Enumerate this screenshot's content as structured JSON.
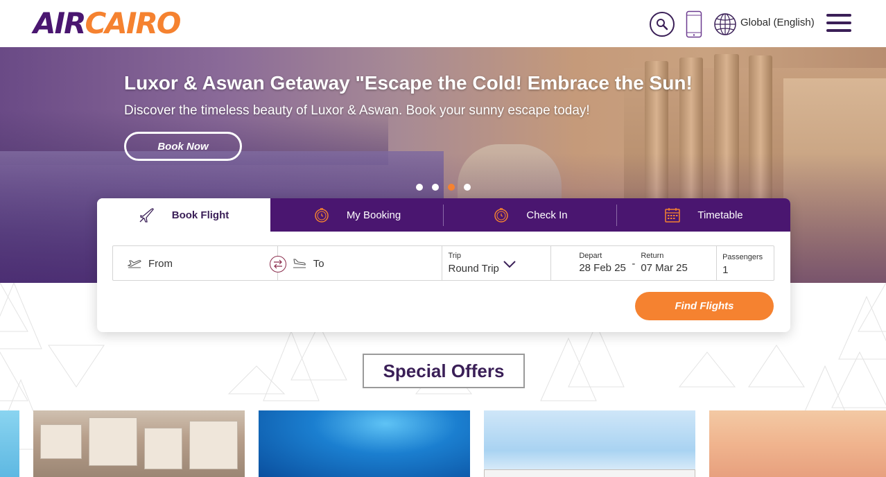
{
  "header": {
    "logo": {
      "part1": "AIR",
      "part2": "CAIRO"
    },
    "language": "Global (English)",
    "icons": [
      "search-icon",
      "mobile-icon",
      "globe-icon",
      "menu-icon"
    ]
  },
  "hero": {
    "title": "Luxor & Aswan Getaway \"Escape the Cold! Embrace the Sun!",
    "subtitle": "Discover the timeless beauty of Luxor & Aswan. Book your sunny escape today!",
    "cta": "Book Now",
    "slides": {
      "count": 4,
      "active_index": 2
    }
  },
  "booking": {
    "tabs": [
      {
        "label": "Book Flight",
        "icon": "plane-icon",
        "active": true
      },
      {
        "label": "My Booking",
        "icon": "clock-icon",
        "active": false
      },
      {
        "label": "Check In",
        "icon": "clock-icon",
        "active": false
      },
      {
        "label": "Timetable",
        "icon": "calendar-icon",
        "active": false
      }
    ],
    "from_placeholder": "From",
    "to_placeholder": "To",
    "trip_label": "Trip",
    "trip_value": "Round Trip",
    "depart_label": "Depart",
    "depart_value": "28 Feb 25",
    "return_label": "Return",
    "return_value": "07 Mar 25",
    "date_separator": "-",
    "passengers_label": "Passengers",
    "passengers_value": "1",
    "find_button": "Find Flights"
  },
  "offers": {
    "title": "Special Offers"
  },
  "colors": {
    "brand_purple": "#4a1670",
    "brand_orange": "#f58230"
  }
}
